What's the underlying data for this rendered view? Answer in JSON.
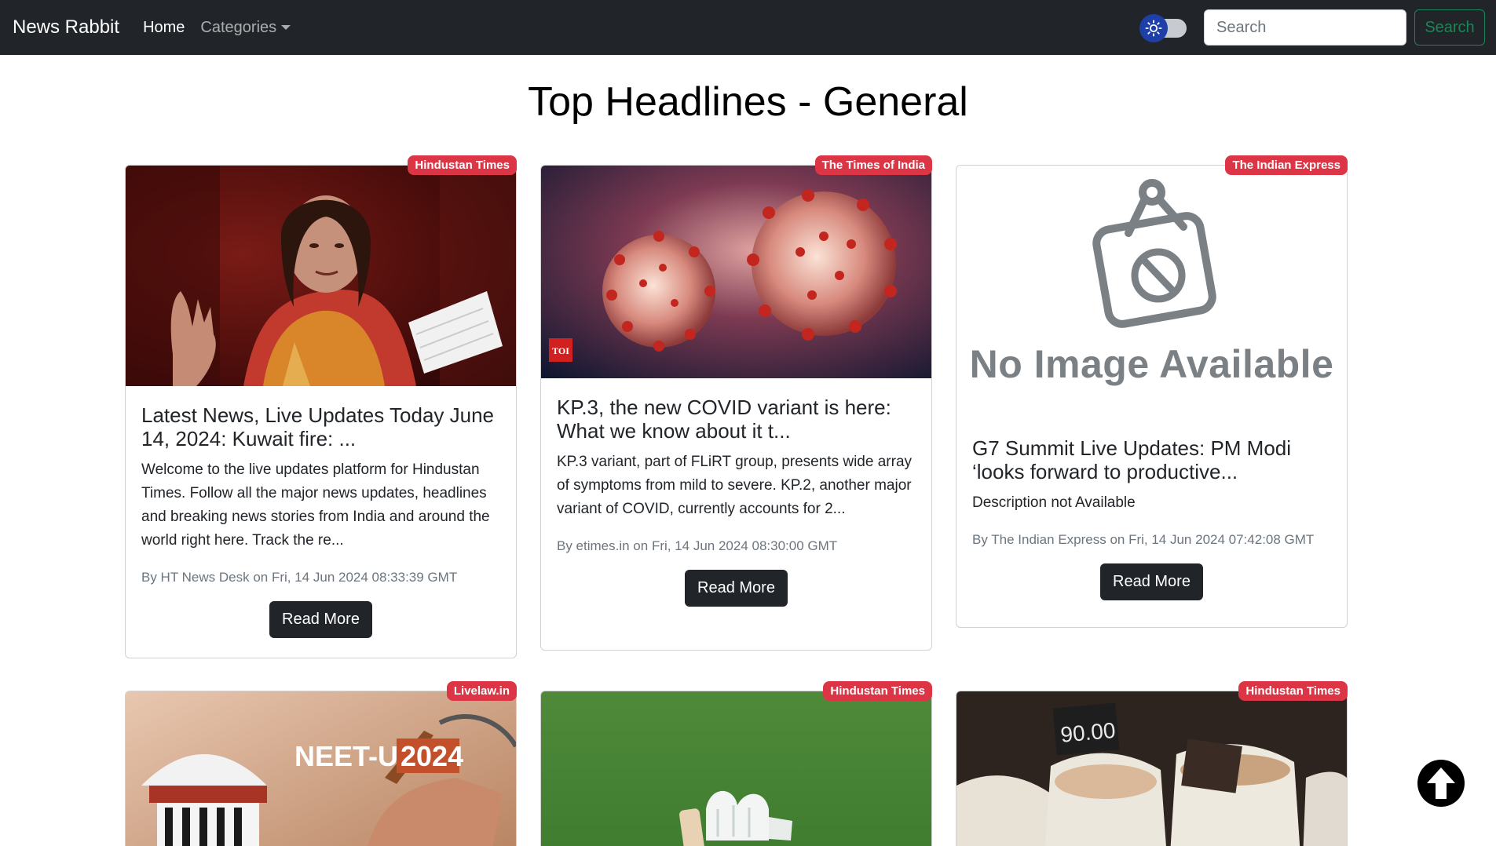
{
  "navbar": {
    "brand": "News Rabbit",
    "home": "Home",
    "categories": "Categories",
    "search_placeholder": "Search",
    "search_button": "Search",
    "theme_toggle_icon": "sun-icon"
  },
  "page": {
    "title": "Top Headlines - General"
  },
  "articles": [
    {
      "source": "Hindustan Times",
      "title": "Latest News, Live Updates Today June 14, 2024: Kuwait fire: ...",
      "description": "Welcome to the live updates platform for Hindustan Times. Follow all the major news updates, headlines and breaking news stories from India and around the world right here. Track the re...",
      "meta": "By HT News Desk on Fri, 14 Jun 2024 08:33:39 GMT",
      "button": "Read More",
      "image": "photo-woman-speaking-parliament"
    },
    {
      "source": "The Times of India",
      "title": "KP.3, the new COVID variant is here: What we know about it t...",
      "description": "KP.3 variant, part of FLiRT group, presents wide array of symptoms from mild to severe. KP.2, another major variant of COVID, currently accounts for 2...",
      "meta": "By etimes.in on Fri, 14 Jun 2024 08:30:00 GMT",
      "button": "Read More",
      "image": "photo-virus-particles",
      "image_logo": "TOI"
    },
    {
      "source": "The Indian Express",
      "title": "G7 Summit Live Updates: PM Modi ‘looks forward to productive...",
      "description": "Description not Available",
      "meta": "By The Indian Express on Fri, 14 Jun 2024 07:42:08 GMT",
      "button": "Read More",
      "image": "no-image-placeholder",
      "image_text": "No Image Available"
    },
    {
      "source": "Livelaw.in",
      "image": "photo-neet-ug-court",
      "image_text_a": "NEET-UG",
      "image_text_b": "2024"
    },
    {
      "source": "Hindustan Times",
      "image": "photo-cricket-gloves-grass"
    },
    {
      "source": "Hindustan Times",
      "image": "photo-grain-sacks-market",
      "image_text": "90.00"
    }
  ],
  "colors": {
    "navbar": "#212529",
    "badge": "#dc3545",
    "search_button": "#198754",
    "toggle_knob": "#1f3fa8"
  }
}
